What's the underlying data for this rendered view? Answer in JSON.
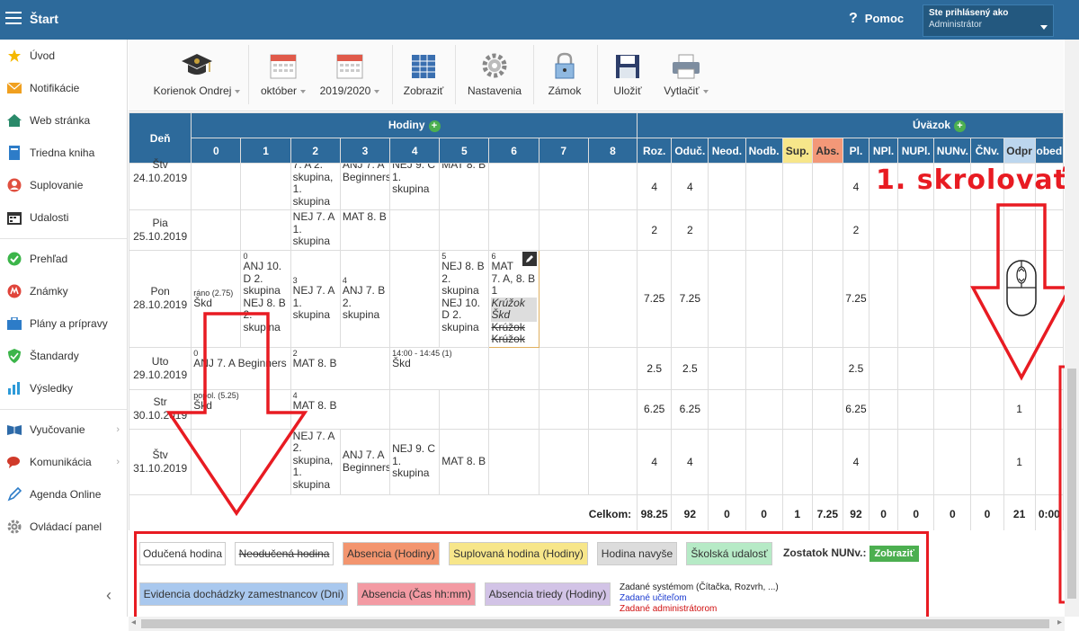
{
  "topbar": {
    "title": "Štart",
    "help": "Pomoc",
    "user_label": "Ste prihlásený ako",
    "user_role": "Administrátor"
  },
  "sidebar": {
    "items": [
      {
        "label": "Úvod",
        "icon": "star-icon"
      },
      {
        "label": "Notifikácie",
        "icon": "envelope-icon"
      },
      {
        "label": "Web stránka",
        "icon": "home-icon"
      },
      {
        "label": "Triedna kniha",
        "icon": "book-icon"
      },
      {
        "label": "Suplovanie",
        "icon": "user-icon"
      },
      {
        "label": "Udalosti",
        "icon": "calendar-icon"
      },
      {
        "label": "Prehľad",
        "icon": "check-circle-icon"
      },
      {
        "label": "Známky",
        "icon": "grade-icon"
      },
      {
        "label": "Plány a prípravy",
        "icon": "briefcase-icon"
      },
      {
        "label": "Štandardy",
        "icon": "shield-icon"
      },
      {
        "label": "Výsledky",
        "icon": "bar-chart-icon"
      },
      {
        "label": "Vyučovanie",
        "icon": "open-book-icon"
      },
      {
        "label": "Komunikácia",
        "icon": "chat-icon"
      },
      {
        "label": "Agenda Online",
        "icon": "pen-icon"
      },
      {
        "label": "Ovládací panel",
        "icon": "gear-icon"
      }
    ]
  },
  "toolbar": {
    "teacher": "Korienok Ondrej",
    "month": "október",
    "year": "2019/2020",
    "show": "Zobraziť",
    "settings": "Nastavenia",
    "lock": "Zámok",
    "save": "Uložiť",
    "print": "Vytlačiť"
  },
  "table": {
    "day_header": "Deň",
    "hours_header": "Hodiny",
    "load_header": "Úväzok",
    "hours": [
      "0",
      "1",
      "2",
      "3",
      "4",
      "5",
      "6",
      "7",
      "8"
    ],
    "load_cols": [
      "Roz.",
      "Oduč.",
      "Neod.",
      "Nodb.",
      "Sup.",
      "Abs.",
      "Pl.",
      "NPl.",
      "NUPl.",
      "NUNv.",
      "ČNv.",
      "Odpr",
      "obed"
    ],
    "rows": [
      {
        "day": "Štv",
        "date": "24.10.2019",
        "h2": "7. A 2. skupina, 1. skupina",
        "h3": "ANJ 7. A Beginners",
        "h4": "NEJ 9. C 1. skupina",
        "h5": "MAT 8. B",
        "roz": "4",
        "oduc": "4",
        "pl": "4",
        "odpr": ""
      },
      {
        "day": "Pia",
        "date": "25.10.2019",
        "h2": "NEJ 7. A 1. skupina",
        "h3": "MAT 8. B",
        "roz": "2",
        "oduc": "2",
        "pl": "2",
        "odpr": ""
      },
      {
        "day": "Pon",
        "date": "28.10.2019",
        "h0small": "ráno (2.75)",
        "h0": "Škd",
        "h1small": "0",
        "h1": "ANJ 10. D 2. skupina NEJ 8. B 2. skupina",
        "h2small": "3",
        "h2": "NEJ 7. A 1. skupina",
        "h3small": "4",
        "h3": "ANJ 7. B 2. skupina",
        "h5small": "5",
        "h5": "NEJ 8. B 2. skupina NEJ 10. D 2. skupina",
        "h6small": "6",
        "h6a": "MAT",
        "h6b": "7. A, 8. B 1",
        "h6c": "Krúžok",
        "h6d": "Škd",
        "h6e": "Krúžok",
        "h6f": "Krúžok",
        "roz": "7.25",
        "oduc": "7.25",
        "pl": "7.25",
        "odpr": ""
      },
      {
        "day": "Uto",
        "date": "29.10.2019",
        "h0small": "0",
        "h0": "ANJ 7. A Beginners",
        "h2small": "2",
        "h2": "MAT 8. B",
        "h4small": "14:00 - 14:45 (1)",
        "h4": "Škd",
        "roz": "2.5",
        "oduc": "2.5",
        "pl": "2.5",
        "odpr": ""
      },
      {
        "day": "Str",
        "date": "30.10.2019",
        "h0small": "popol. (5.25)",
        "h0": "Škd",
        "h2small": "4",
        "h2": "MAT 8. B",
        "roz": "6.25",
        "oduc": "6.25",
        "pl": "6.25",
        "odpr": "1"
      },
      {
        "day": "Štv",
        "date": "31.10.2019",
        "h2": "NEJ 7. A 2. skupina, 1. skupina",
        "h3": "ANJ 7. A Beginners",
        "h4": "NEJ 9. C 1. skupina",
        "h5": "MAT 8. B",
        "roz": "4",
        "oduc": "4",
        "pl": "4",
        "odpr": "1"
      }
    ],
    "totals_label": "Celkom:",
    "totals": [
      "98.25",
      "92",
      "0",
      "0",
      "1",
      "7.25",
      "92",
      "0",
      "0",
      "0",
      "0",
      "21",
      "0:00"
    ]
  },
  "legend": {
    "items": [
      "Odučená hodina",
      "Neodučená hodina",
      "Absencia (Hodiny)",
      "Suplovaná hodina (Hodiny)",
      "Hodina navyše",
      "Školská udalosť",
      "Evidencia dochádzky zamestnancov (Dni)",
      "Absencia (Čas hh:mm)",
      "Absencia triedy (Hodiny)"
    ],
    "nunv_label": "Zostatok NUNv.:",
    "nunv_button": "Zobraziť",
    "system": "Zadané systémom (Čítačka, Rozvrh, ...)",
    "teacher": "Zadané učiteľom",
    "admin": "Zadané administrátorom"
  },
  "annotation": {
    "number": "1.",
    "text": "skrolovať"
  },
  "colors": {
    "header": "#2d6a9b",
    "annotation": "#e81b22",
    "sup": "#f7e68a",
    "abs": "#f39878",
    "odpr": "#bcd6ee"
  }
}
